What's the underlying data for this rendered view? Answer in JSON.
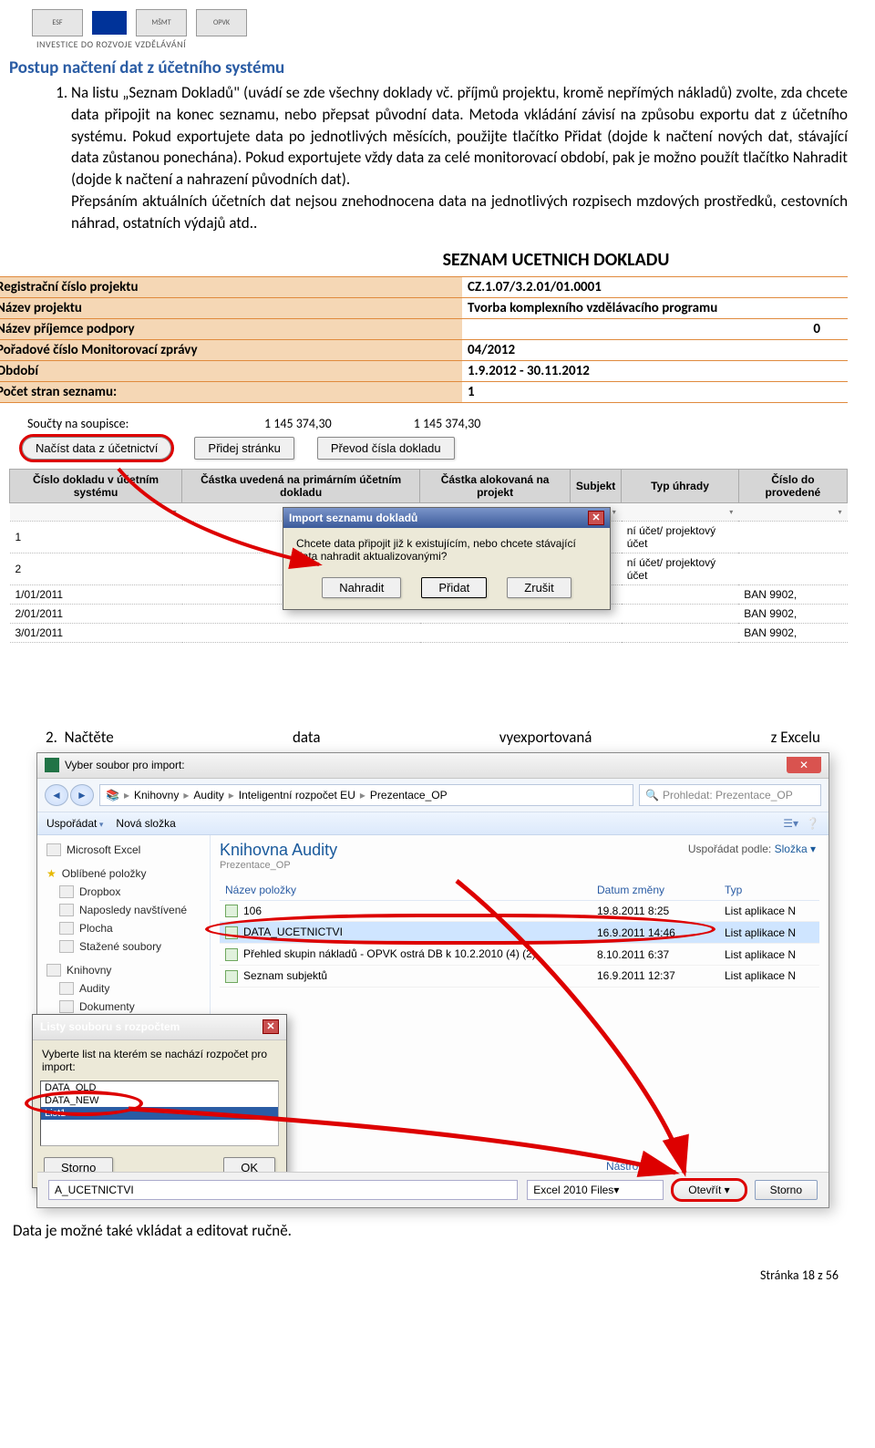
{
  "logos": {
    "invest_line": "INVESTICE DO ROZVOJE VZDĚLÁVÁNÍ"
  },
  "heading": "Postup načtení dat z účetního systému",
  "paragraph1": "Na listu „Seznam Dokladů\" (uvádí se zde všechny doklady vč. příjmů projektu, kromě nepřímých nákladů) zvolte, zda chcete data připojit na konec seznamu, nebo přepsat původní data. Metoda vkládání závisí na způsobu exportu dat z účetního systému. Pokud exportujete data po jednotlivých měsících, použijte tlačítko Přidat (dojde k načtení nových dat, stávající data zůstanou ponechána). Pokud exportujete vždy data za celé monitorovací období, pak je možno použít tlačítko Nahradit (dojde k načtení a nahrazení původních dat).\nPřepsáním aktuálních účetních dat nejsou znehodnocena data na jednotlivých rozpisech mzdových prostředků, cestovních náhrad, ostatních výdajů atd..",
  "seznam": {
    "title": "SEZNAM UCETNICH DOKLADU",
    "rows": [
      {
        "label": "Registrační číslo projektu",
        "value": "CZ.1.07/3.2.01/01.0001"
      },
      {
        "label": "Název projektu",
        "value": "Tvorba komplexního vzdělávacího programu"
      },
      {
        "label": "Název příjemce podpory",
        "value": "0",
        "right": true
      },
      {
        "label": "Pořadové číslo Monitorovací zprávy",
        "value": "04/2012"
      },
      {
        "label": "Období",
        "value": "1.9.2012 - 30.11.2012"
      },
      {
        "label": "Počet stran seznamu:",
        "value": "1"
      }
    ]
  },
  "totals": {
    "label": "Součty na soupisce:",
    "v1": "1 145 374,30",
    "v2": "1 145 374,30"
  },
  "buttons": {
    "load": "Načíst data z účetnictví",
    "add_page": "Přidej stránku",
    "convert": "Převod čísla dokladu"
  },
  "grid": {
    "headers": [
      "Číslo dokladu v účetním systému",
      "Částka uvedená na primárním účetním dokladu",
      "Částka alokovaná na projekt",
      "Subjekt",
      "Typ úhrady",
      "Číslo do provedené"
    ],
    "rows": [
      {
        "c1": "1",
        "c5": "ní účet/ projektový účet",
        "c6": ""
      },
      {
        "c1": "2",
        "c5": "ní účet/ projektový účet",
        "c6": ""
      },
      {
        "c1": "1/01/2011",
        "c5": "",
        "c6": "BAN 9902,"
      },
      {
        "c1": "2/01/2011",
        "c5": "",
        "c6": "BAN 9902,"
      },
      {
        "c1": "3/01/2011",
        "c5": "",
        "c6": "BAN 9902,"
      }
    ]
  },
  "import_dlg": {
    "title": "Import seznamu dokladů",
    "msg": "Chcete data připojit již k existujícím, nebo chcete stávající data nahradit aktualizovanými?",
    "replace": "Nahradit",
    "add": "Přidat",
    "cancel": "Zrušit"
  },
  "step2": {
    "num": "2.",
    "w1": "Načtěte",
    "w2": "data",
    "w3": "vyexportovaná",
    "w4": "z Excelu"
  },
  "picker": {
    "title": "Vyber soubor pro import:",
    "breadcrumb": [
      "Knihovny",
      "Audity",
      "Inteligentní rozpočet EU",
      "Prezentace_OP"
    ],
    "search_placeholder": "Prohledat: Prezentace_OP",
    "organize": "Uspořádat",
    "new_folder": "Nová složka",
    "sidebar": {
      "excel": "Microsoft Excel",
      "fav": "Oblíbené položky",
      "fav_items": [
        "Dropbox",
        "Naposledy navštívené",
        "Plocha",
        "Stažené soubory"
      ],
      "libs": "Knihovny",
      "libs_items": [
        "Audity",
        "Dokumenty"
      ]
    },
    "lib_title": "Knihovna Audity",
    "lib_sub": "Prezentace_OP",
    "sort_label": "Uspořádat podle:",
    "sort_value": "Složka",
    "cols": {
      "name": "Název položky",
      "date": "Datum změny",
      "type": "Typ"
    },
    "files": [
      {
        "name": "106",
        "date": "19.8.2011 8:25",
        "type": "List aplikace N"
      },
      {
        "name": "DATA_UCETNICTVI",
        "date": "16.9.2011 14:46",
        "type": "List aplikace N",
        "sel": true
      },
      {
        "name": "Přehled skupin nákladů - OPVK ostrá DB k 10.2.2010 (4) (2)",
        "date": "8.10.2011 6:37",
        "type": "List aplikace N"
      },
      {
        "name": "Seznam subjektů",
        "date": "16.9.2011 12:37",
        "type": "List aplikace N"
      }
    ],
    "filename": "A_UCETNICTVI",
    "filetype": "Excel 2010 Files",
    "tools": "Nástroje",
    "open": "Otevřít",
    "cancel": "Storno"
  },
  "sheet_dlg": {
    "title": "Listy souboru s rozpočtem",
    "prompt": "Vyberte list na kterém se nachází rozpočet pro import:",
    "items": [
      "DATA_OLD",
      "DATA_NEW",
      "List1"
    ],
    "cancel": "Storno",
    "ok": "OK"
  },
  "footer": "Data je možné také vkládat a editovat ručně.",
  "page": "Stránka 18 z 56"
}
